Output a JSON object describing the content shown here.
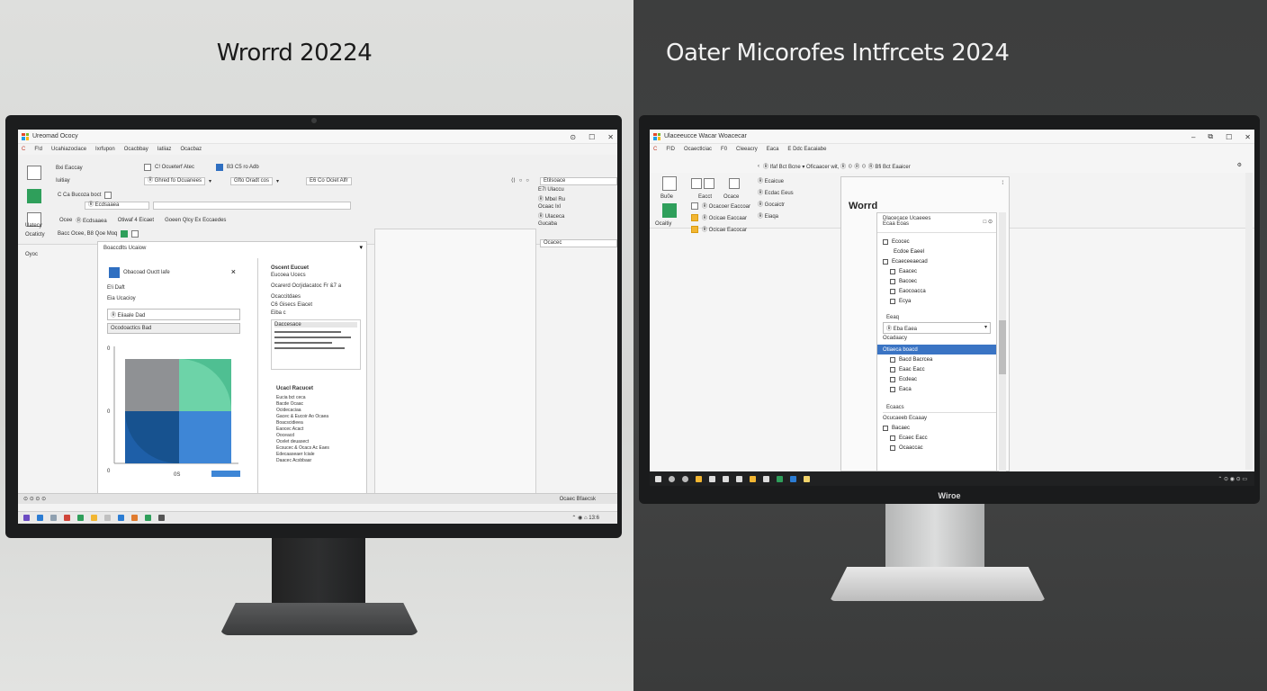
{
  "headings": {
    "left": "Wrorrd 20224",
    "right": "Oater Micorofes Intfrcets 2024"
  },
  "left_window": {
    "title": "Ureomad Ococy",
    "menu": [
      "C",
      "F!d",
      "Ucahiazoclace",
      "Ixrfupon",
      "Ocacbbay",
      "Iatiiaz",
      "Ocacbaz"
    ],
    "ribbon": {
      "col1": [
        "Bxi Eaccay",
        "Iuitiay"
      ],
      "row_a": "C! Ocueterf Atec",
      "row_b": "Ⓡ Ghred fo Ocuanees",
      "row_c": "Gfto Oradt cos",
      "row_d": "B3 C5 ro Adb",
      "row_e": "E6 Co Ociet Alfr",
      "row_f": "C Ca Bucoza boct",
      "side_list": [
        "E7l Ulaccu",
        "Ⓡ Mbel Ru",
        "Ocaac Ixl",
        "Ⓡ Ulaceca",
        "Gucaba",
        "Ocacec"
      ],
      "search": "Etilsoace",
      "left_labels": [
        "Uatecy",
        "Ocaticty",
        "Oyoc"
      ]
    },
    "toolbar": {
      "a": "Ⓡ Ecdsaaea",
      "b": "Otiwaf 4 Eicaet",
      "c": "Goeen Qlcy Ex Eccaedes",
      "d": "Ocee",
      "e": "Bacc Ocee, B8 Qoe Moq"
    },
    "subtool": "Boaccdlts Ucaiow",
    "dialog": {
      "title": "Obacoad Ouctt lafe",
      "lines": [
        "E!i Daft",
        "Eia Ucacioy",
        "Ⓡ Eiiaale Dad",
        "Ocodoactics Bad"
      ],
      "close": "×"
    },
    "chart_axis": {
      "y_top": "0",
      "y_mid": "0",
      "x": "0",
      "label": "0S"
    },
    "right_pane": {
      "title": "Oscent Eucuet",
      "sub": "Eucoea Ucecs",
      "lines": [
        "Ocarerd Ocrjidacatoc Fr &7 a",
        "Ocaccitdaes",
        "C6 Gisecs Eiacet",
        "Eiba c"
      ],
      "block_title": "Daccesace",
      "block_title2": "Ucacl Racucet",
      "list": [
        "Eucia bct ceca",
        "Bacde Ocaac",
        "Ocidecaciaa",
        "Gacec & Eucoir Ao Ocaea",
        "Boacscidieea",
        "Eaocec Acact",
        "Ooceacd",
        "Ocelet deuasect",
        "Ecsucec & Ocacs Ac Eaes",
        "Edecaaseaer Iciale",
        "Daacec Acsbbaar"
      ]
    },
    "status": [
      "Ocaec Bfaecsk"
    ],
    "taskbar_time": "⌃ ◉ ⌂ 13:6"
  },
  "right_window": {
    "title": "Ulaceeucce Wacar Woacecar",
    "menu": [
      "C",
      "F!D",
      "Ocaectlciac",
      "F0",
      "Cleeacry",
      "Eaca",
      "E Ddc Eacaiabe"
    ],
    "quickbar": "Ⓡ Ifaf Bct Bcne ▾   Oficaacer wit, Ⓡ ☉ Ⓡ ☉ Ⓡ Bfi Bct Eaaicer",
    "ribbon": {
      "col_a": [
        "Bu0e",
        "Ocaitiy"
      ],
      "col_b": [
        "Eacct",
        "Ocace",
        "Ocoace"
      ],
      "col_c": [
        "Ⓡ Ecaicue",
        "Ⓡ Ecdac Eeus",
        "Ⓡ Gocaictr",
        "Ⓡ Eiaqa"
      ],
      "col_d": [
        "Ⓡ Ocacoer Eaccoar",
        "Ⓡ Ocicae Eaccaar",
        "Ⓡ Ocicae Eacocar"
      ]
    },
    "doc_title": "Worrd",
    "pane": {
      "header": "Dlacecace Ucaeees",
      "sub": "Ecaa Eoas",
      "items_a": [
        "Ecocec",
        "Ecdoe Eaeel",
        "Ecaeceeaecad"
      ],
      "items_b": [
        "Eaacec",
        "Bacoec",
        "Eaocoacca",
        "Ecya"
      ],
      "group": "Eeaq",
      "dropdown": "Ⓡ Eba Eaea",
      "dropdown_sub": "Ocadaacy",
      "selected": "Otiaeca boacd",
      "items_c": [
        "Bacd Bacrcea",
        "Eaac Eacc",
        "Ecdeac",
        "Eaca"
      ],
      "group2": "Ecaacs",
      "group3": "Ocucaeeb Ecaaay",
      "items_d": [
        "Bacaec",
        "Ecaec Eacc",
        "Ocaaccac"
      ]
    },
    "brand": "Wiroe"
  }
}
